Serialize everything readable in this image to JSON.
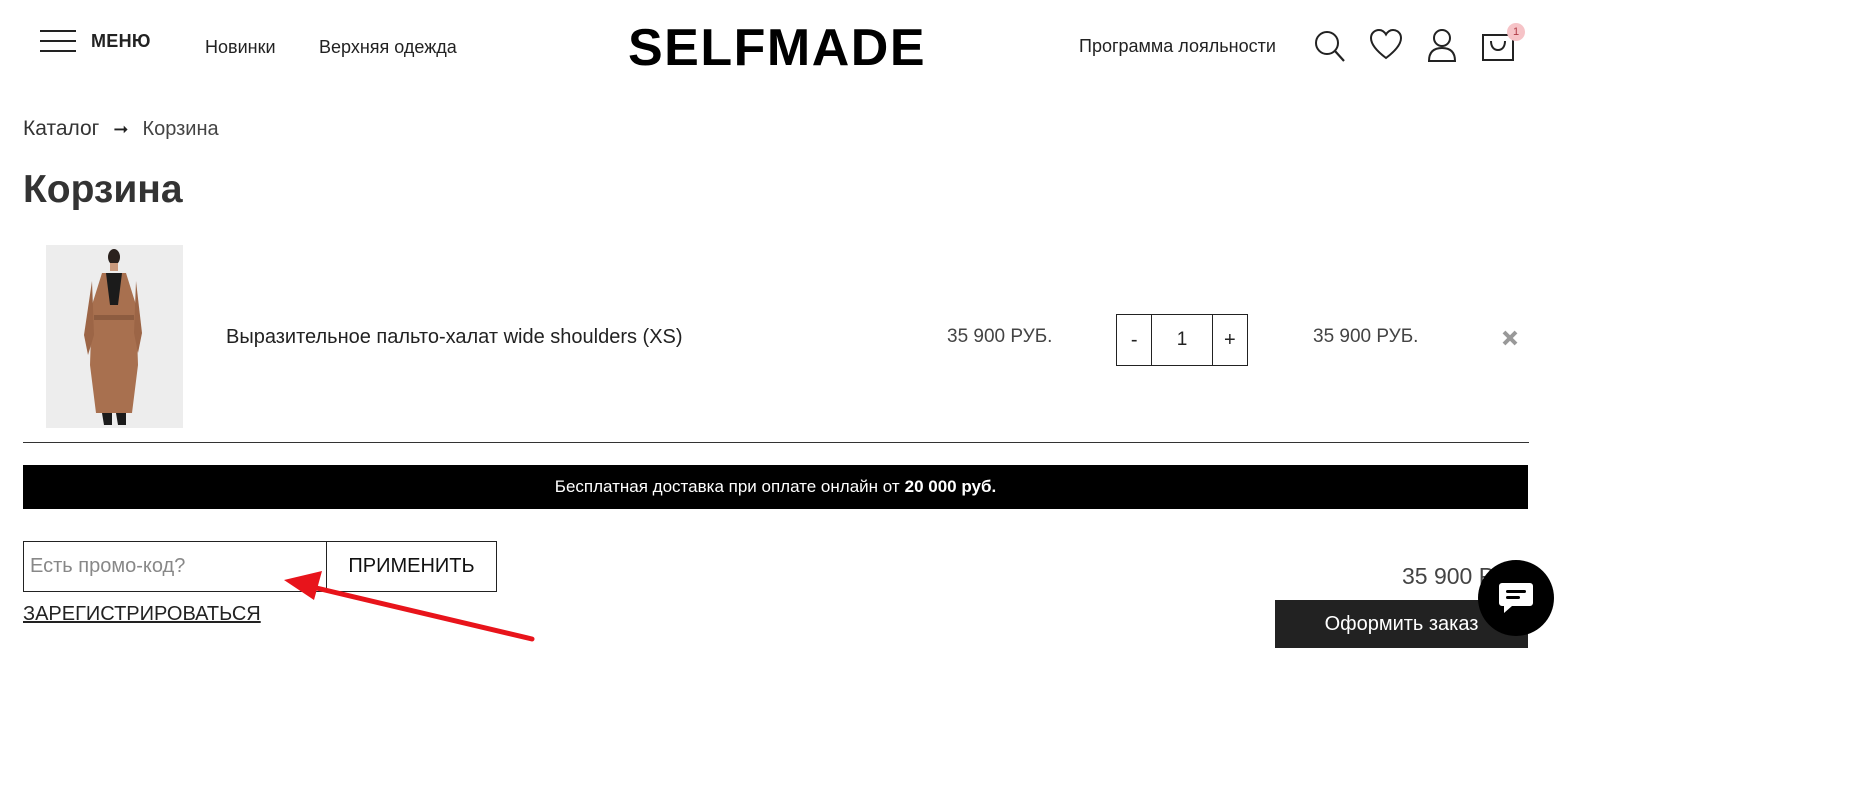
{
  "header": {
    "menu_label": "МЕНЮ",
    "nav": [
      "Новинки",
      "Верхняя одежда"
    ],
    "logo": "SELFMADE",
    "loyalty": "Программа лояльности",
    "cart_count": "1",
    "icons": [
      "search-icon",
      "heart-icon",
      "user-icon",
      "cart-icon"
    ]
  },
  "breadcrumb": {
    "root": "Каталог",
    "arrow": "➞",
    "current": "Корзина"
  },
  "page_title": "Корзина",
  "cart": {
    "items": [
      {
        "name": "Выразительное пальто-халат wide shoulders (XS)",
        "price": "35 900 РУБ.",
        "qty": "1",
        "minus": "-",
        "plus": "+",
        "subtotal": "35 900 РУБ."
      }
    ]
  },
  "delivery": {
    "text": "Бесплатная доставка при оплате онлайн от",
    "amount": "20 000 руб."
  },
  "promo": {
    "placeholder": "Есть промо-код?",
    "apply_label": "ПРИМЕНИТЬ"
  },
  "register_label": "ЗАРЕГИСТРИРОВАТЬСЯ",
  "total": "35 900 Р",
  "checkout_label": "Оформить заказ",
  "colors": {
    "banner_bg": "#000000",
    "checkout_bg": "#222222",
    "badge_bg": "#f6c3c7",
    "annotation": "#e8141b"
  }
}
